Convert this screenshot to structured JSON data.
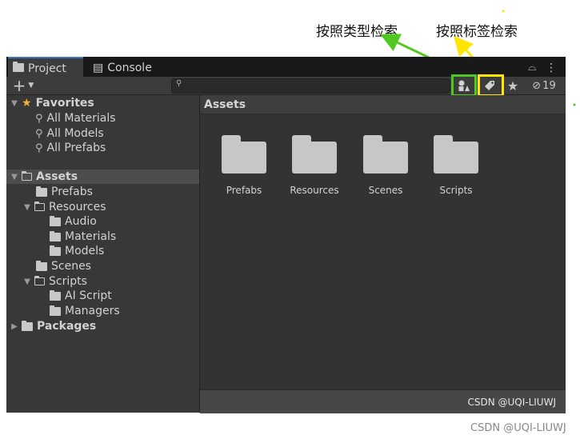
{
  "annotations": {
    "search_by_type": "按照类型检索",
    "search_by_label": "按照标签检索",
    "green": "#4fc81f",
    "yellow": "#ffe600"
  },
  "tabs": [
    {
      "label": "Project",
      "icon": "folder-icon",
      "active": true
    },
    {
      "label": "Console",
      "icon": "console-icon",
      "active": false
    }
  ],
  "toolbar": {
    "add_label": "+",
    "search_placeholder": "",
    "hidden_count": "19"
  },
  "favorites": {
    "label": "Favorites",
    "items": [
      "All Materials",
      "All Models",
      "All Prefabs"
    ]
  },
  "tree": {
    "assets": "Assets",
    "prefabs": "Prefabs",
    "resources": "Resources",
    "audio": "Audio",
    "materials": "Materials",
    "models": "Models",
    "scenes": "Scenes",
    "scripts": "Scripts",
    "ai_script": "AI Script",
    "managers": "Managers",
    "packages": "Packages"
  },
  "content": {
    "title": "Assets",
    "items": [
      "Prefabs",
      "Resources",
      "Scenes",
      "Scripts"
    ]
  },
  "watermark": "CSDN @UQI-LIUWJ"
}
